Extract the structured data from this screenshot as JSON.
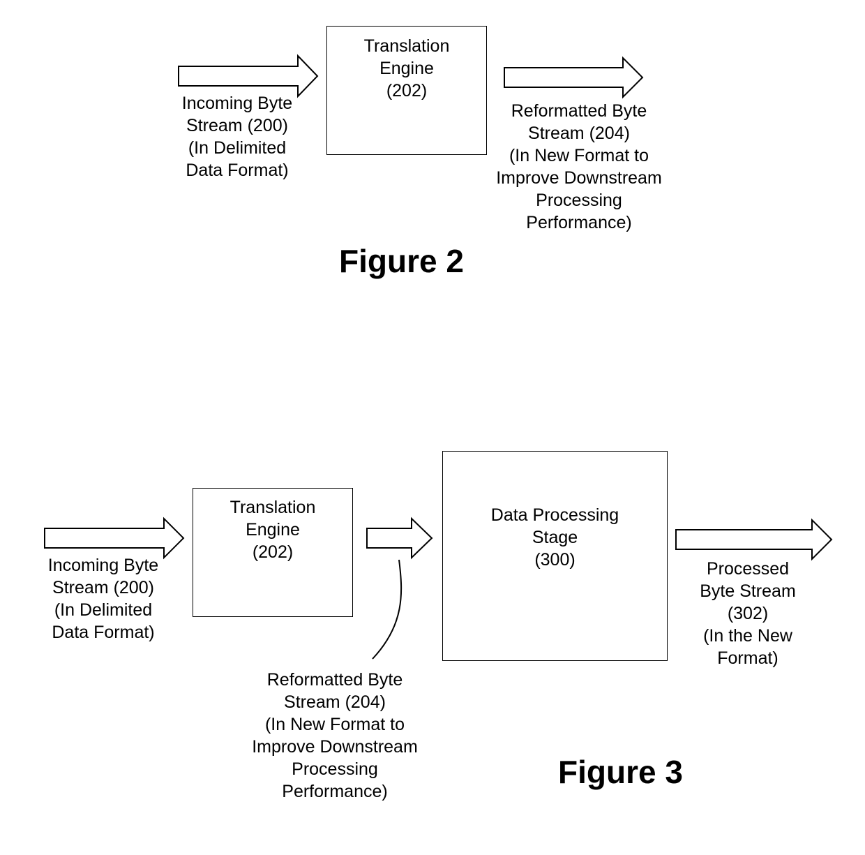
{
  "figure2": {
    "title": "Figure 2",
    "incoming_label": "Incoming Byte\nStream (200)\n(In Delimited\nData Format)",
    "engine_label": "Translation\nEngine\n(202)",
    "reformatted_label": "Reformatted Byte\nStream (204)\n(In New Format to\nImprove Downstream\nProcessing\nPerformance)"
  },
  "figure3": {
    "title": "Figure 3",
    "incoming_label": "Incoming Byte\nStream (200)\n(In Delimited\nData Format)",
    "engine_label": "Translation\nEngine\n(202)",
    "stage_label": "Data Processing\nStage\n(300)",
    "reformatted_label": "Reformatted Byte\nStream (204)\n(In New Format to\nImprove Downstream\nProcessing\nPerformance)",
    "processed_label": "Processed\nByte Stream\n(302)\n(In the New\nFormat)"
  }
}
